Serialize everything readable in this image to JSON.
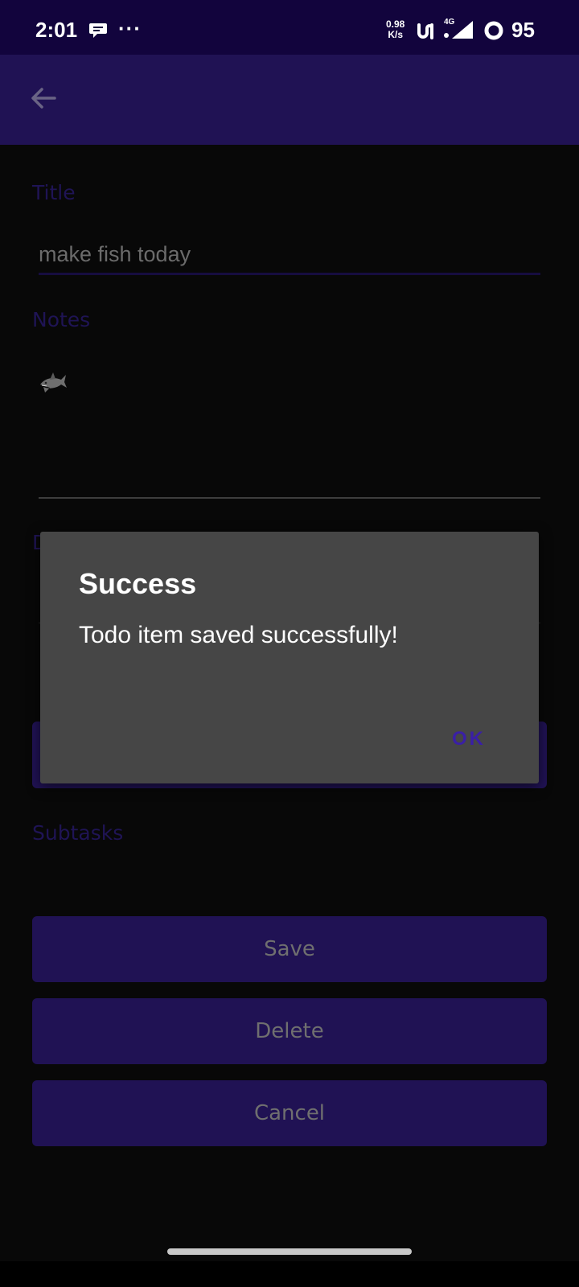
{
  "status_bar": {
    "time": "2:01",
    "more_indicator": "···",
    "net_speed_value": "0.98",
    "net_speed_unit": "K/s",
    "network_type": "4G",
    "battery": "95",
    "icons": [
      "chat-bubble-icon",
      "vowifi-icon",
      "signal-icon",
      "battery-ring-icon"
    ]
  },
  "app_bar": {
    "back_icon": "arrow-left-icon"
  },
  "form": {
    "title_label": "Title",
    "title_value": "make fish today",
    "notes_label": "Notes",
    "notes_value": "🦈",
    "due_label_partial": "D",
    "subtasks_label": "Subtasks"
  },
  "buttons": {
    "save": "Save",
    "delete": "Delete",
    "cancel": "Cancel"
  },
  "dialog": {
    "title": "Success",
    "message": "Todo item saved successfully!",
    "ok": "OK"
  },
  "colors": {
    "status_bar": "#12043d",
    "app_bar": "#201254",
    "accent": "#3a1fa6",
    "dialog_bg": "#464646",
    "background": "#080808"
  }
}
